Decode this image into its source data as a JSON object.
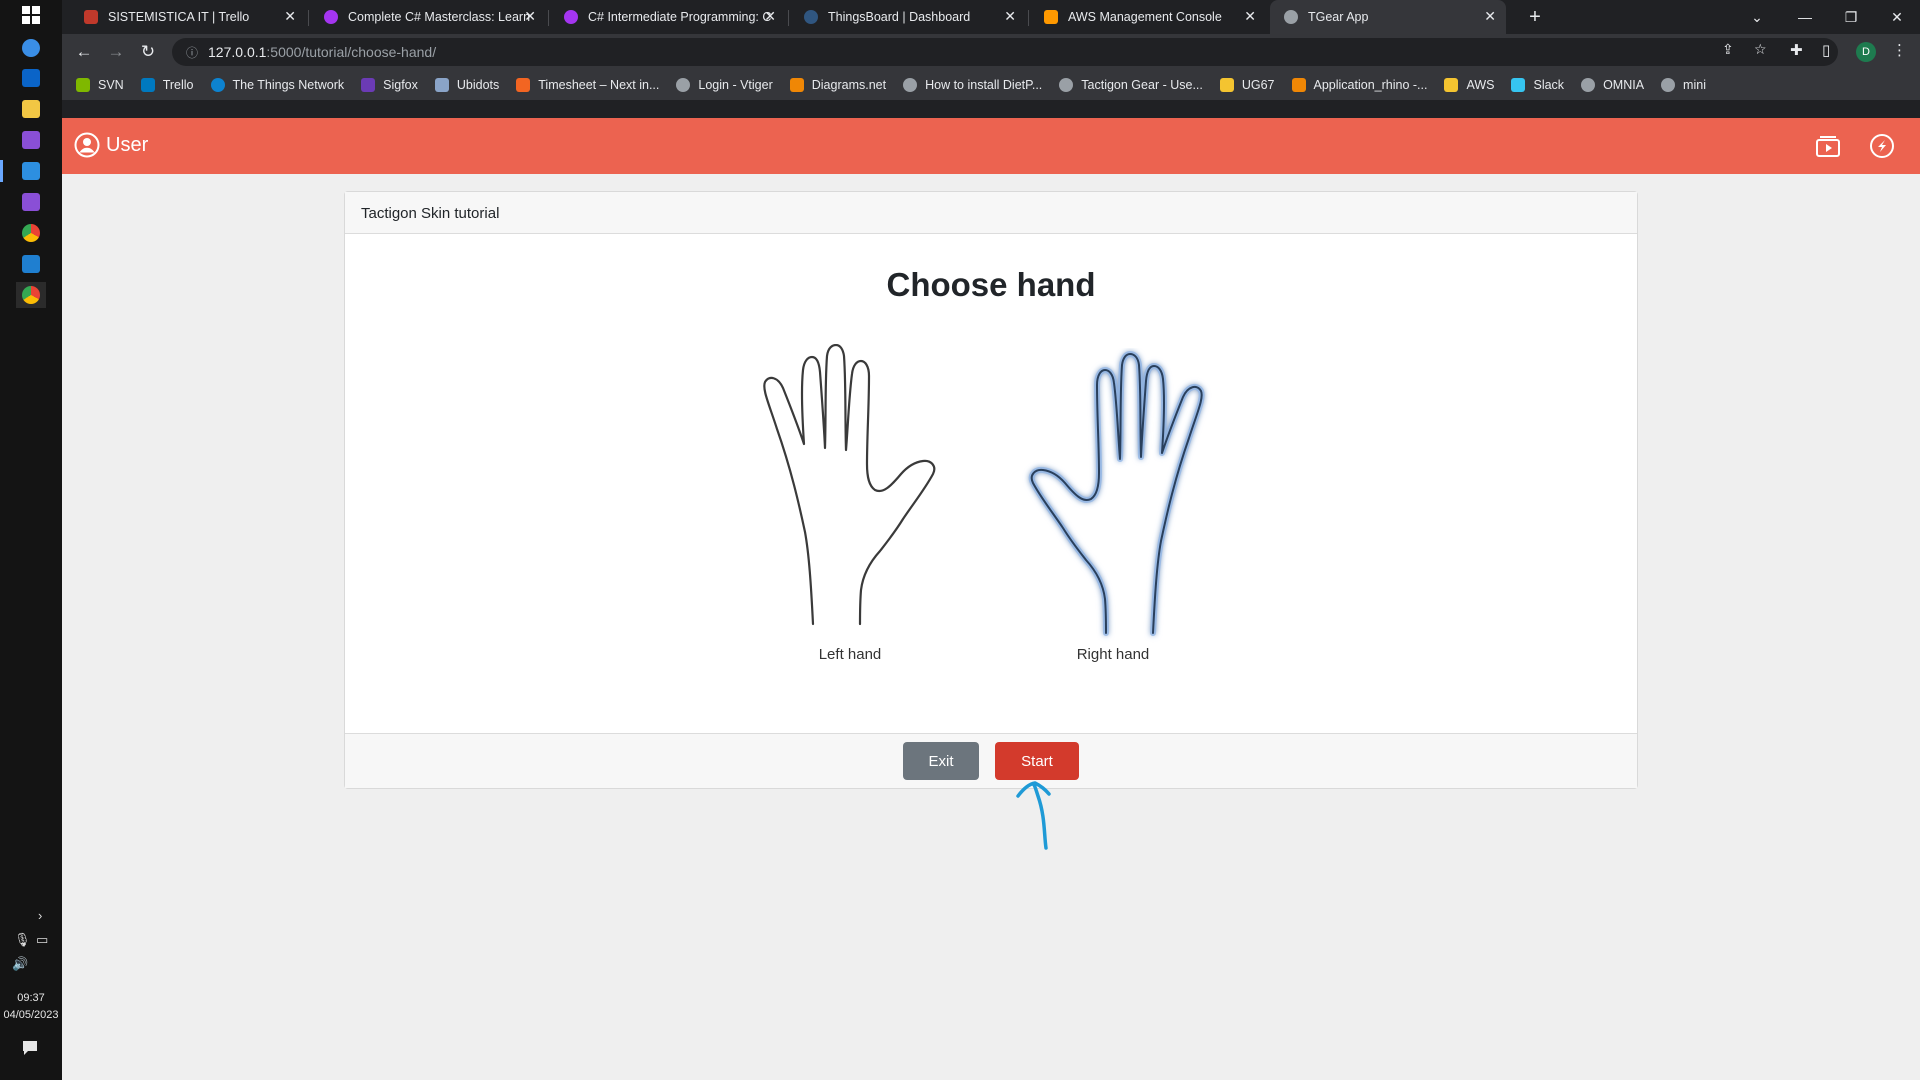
{
  "browser": {
    "tabs": [
      {
        "title": "SISTEMISTICA IT | Trello",
        "color": "#c0392b"
      },
      {
        "title": "Complete C# Masterclass: Learn",
        "color": "#a435f0"
      },
      {
        "title": "C# Intermediate Programming: C",
        "color": "#a435f0"
      },
      {
        "title": "ThingsBoard | Dashboard",
        "color": "#305680"
      },
      {
        "title": "AWS Management Console",
        "color": "#ff9900"
      },
      {
        "title": "TGear App",
        "color": "#9aa0a6",
        "active": true
      }
    ],
    "new_tab": "+",
    "url_host": "127.0.0.1",
    "url_path": ":5000/tutorial/choose-hand/",
    "profile_initial": "D",
    "bookmarks": [
      {
        "label": "SVN",
        "color": "#7fb800"
      },
      {
        "label": "Trello",
        "color": "#0079bf"
      },
      {
        "label": "The Things Network",
        "color": "#0d83d0"
      },
      {
        "label": "Sigfox",
        "color": "#6b3bb5"
      },
      {
        "label": "Ubidots",
        "color": "#8aa4c8"
      },
      {
        "label": "Timesheet – Next in...",
        "color": "#f26522"
      },
      {
        "label": "Login - Vtiger",
        "color": "#9aa0a6"
      },
      {
        "label": "Diagrams.net",
        "color": "#f08705"
      },
      {
        "label": "How to install DietP...",
        "color": "#9aa0a6"
      },
      {
        "label": "Tactigon Gear - Use...",
        "color": "#9aa0a6"
      },
      {
        "label": "UG67",
        "color": "#f4c430"
      },
      {
        "label": "Application_rhino -...",
        "color": "#f08705"
      },
      {
        "label": "AWS",
        "color": "#f4c430"
      },
      {
        "label": "Slack",
        "color": "#36c5f0"
      },
      {
        "label": "OMNIA",
        "color": "#9aa0a6"
      },
      {
        "label": "mini",
        "color": "#9aa0a6"
      }
    ]
  },
  "taskbar": {
    "time": "09:37",
    "date": "04/05/2023"
  },
  "app": {
    "user_label": "User",
    "accent": "#ec6350"
  },
  "card": {
    "header": "Tactigon Skin tutorial",
    "title": "Choose hand",
    "left_hand_label": "Left hand",
    "right_hand_label": "Right hand",
    "exit_label": "Exit",
    "start_label": "Start"
  },
  "colors": {
    "start_button": "#d33a2c",
    "exit_button": "#6c757d",
    "selected_glow": "#5b8fd6",
    "annotation": "#1f9ad6"
  }
}
